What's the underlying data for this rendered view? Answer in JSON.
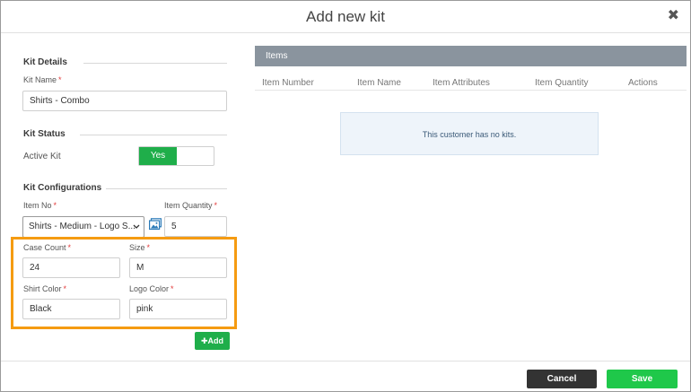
{
  "modal": {
    "title": "Add new kit",
    "close_glyph": "✖"
  },
  "kit_details": {
    "title": "Kit Details",
    "name_label": "Kit Name",
    "name_value": "Shirts - Combo"
  },
  "kit_status": {
    "title": "Kit Status",
    "active_label": "Active Kit",
    "toggle_on_label": "Yes"
  },
  "kit_configurations": {
    "title": "Kit Configurations",
    "item_no_label": "Item No",
    "item_no_value": "Shirts - Medium - Logo S...",
    "item_quantity_label": "Item Quantity",
    "item_quantity_value": "5",
    "case_count_label": "Case Count",
    "case_count_value": "24",
    "size_label": "Size",
    "size_value": "M",
    "shirt_color_label": "Shirt Color",
    "shirt_color_value": "Black",
    "logo_color_label": "Logo Color",
    "logo_color_value": "pink",
    "add_label": "Add"
  },
  "required_mark": "*",
  "items": {
    "title": "Items",
    "columns": [
      "Item Number",
      "Item Name",
      "Item Attributes",
      "Item Quantity",
      "Actions"
    ],
    "empty_message": "This customer has no kits."
  },
  "footer": {
    "cancel_label": "Cancel",
    "save_label": "Save"
  },
  "colors": {
    "accent_green": "#1fae4a",
    "highlight_orange": "#f59b12",
    "header_grey": "#8a949e",
    "cancel_dark": "#333333"
  },
  "icons": {
    "close": "close-icon",
    "item_picker": "image-icon",
    "add": "plus-icon",
    "dropdown": "chevron-down-icon"
  }
}
